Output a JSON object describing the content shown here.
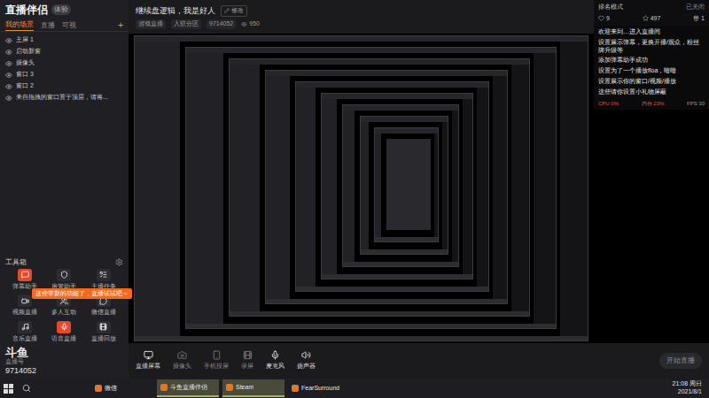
{
  "app": {
    "logo": "直播伴侣",
    "badge": "体验"
  },
  "header": {
    "title": "继续盘逻辑，我是好人",
    "edit": "修改",
    "tags": [
      "游戏直播",
      "入驻分区",
      "9714052"
    ],
    "viewers": "950"
  },
  "sidebar": {
    "tabs": [
      {
        "label": "我的场景",
        "selected": true
      },
      {
        "label": "直播",
        "selected": false
      },
      {
        "label": "可视",
        "selected": false
      }
    ],
    "add": "+",
    "scenes": [
      {
        "label": "主屏 1",
        "visible": true
      },
      {
        "label": "启动新窗",
        "visible": true
      },
      {
        "label": "摄像头",
        "visible": true
      },
      {
        "label": "窗口 3",
        "visible": true
      },
      {
        "label": "窗口 2",
        "visible": true
      },
      {
        "label": "来自拖拽的窗口置于顶层，请将...",
        "visible": true
      }
    ]
  },
  "toolbox": {
    "title": "工具箱",
    "tip": "这些带新的功能了，直播试试吧～",
    "tools": [
      {
        "label": "弹幕助手",
        "highlight": true
      },
      {
        "label": "房管助手",
        "highlight": false
      },
      {
        "label": "主播任务",
        "highlight": false
      },
      {
        "label": "视频直播",
        "highlight": false
      },
      {
        "label": "多人互动",
        "highlight": false
      },
      {
        "label": "微信直播",
        "highlight": false
      },
      {
        "label": "音乐直播",
        "highlight": false
      },
      {
        "label": "语音直播",
        "highlight": true
      },
      {
        "label": "直播回放",
        "highlight": false
      }
    ]
  },
  "room": {
    "logo": "斗鱼",
    "sub": "直播号",
    "id": "9714052"
  },
  "chat": {
    "title": "排名模式",
    "state": "已关闭",
    "stats": [
      "9",
      "497",
      "1"
    ],
    "messages": [
      "欢迎来到…进入直播间",
      "设置展示弹幕，更换开播/观众，粉丝牌升级等",
      "添加弹幕助手成功",
      "设置为了一个播放floa，暗暗",
      "设置展示你的窗口/视频/播放",
      "这些请你设置小礼物屏蔽"
    ]
  },
  "status": {
    "cpu": "CPU 0%",
    "fps": "FPS 30",
    "mem": "内存 23%"
  },
  "controls": [
    {
      "label": "直播屏幕",
      "on": true
    },
    {
      "label": "摄像头",
      "on": false
    },
    {
      "label": "手机投屏",
      "on": false
    },
    {
      "label": "录屏",
      "on": false
    },
    {
      "label": "麦克风",
      "on": true
    },
    {
      "label": "扬声器",
      "on": true
    }
  ],
  "start_button": "开始直播",
  "taskbar": {
    "apps": [
      {
        "label": "微信",
        "active": false
      },
      {
        "label": "斗鱼直播伴侣",
        "active": true
      },
      {
        "label": "Steam",
        "active": true
      },
      {
        "label": "FearSurround",
        "active": false
      }
    ],
    "time": "21:08 周日",
    "date": "2021/8/1"
  }
}
